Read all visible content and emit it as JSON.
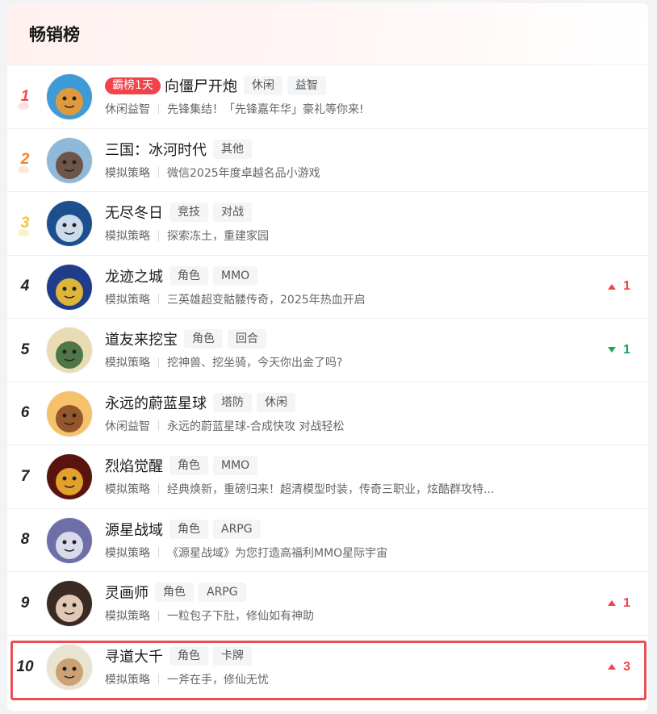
{
  "panel": {
    "title": "畅销榜"
  },
  "rows": [
    {
      "rank": "1",
      "badge": "霸榜1天",
      "name": "向僵尸开炮",
      "tags": [
        "休闲",
        "益智"
      ],
      "category": "休闲益智",
      "desc": "先锋集结！「先锋嘉年华」豪礼等你来!",
      "change": "",
      "dir": "",
      "avatar_bg": "#3f9ad8",
      "avatar_fg": "#f29a2e"
    },
    {
      "rank": "2",
      "badge": "",
      "name": "三国：冰河时代",
      "tags": [
        "其他"
      ],
      "category": "模拟策略",
      "desc": "微信2025年度卓越名品小游戏",
      "change": "",
      "dir": "",
      "avatar_bg": "#8fb9d8",
      "avatar_fg": "#6b4a3a"
    },
    {
      "rank": "3",
      "badge": "",
      "name": "无尽冬日",
      "tags": [
        "竞技",
        "对战"
      ],
      "category": "模拟策略",
      "desc": "探索冻土，重建家园",
      "change": "",
      "dir": "",
      "avatar_bg": "#1d4f8e",
      "avatar_fg": "#dfeaf6"
    },
    {
      "rank": "4",
      "badge": "",
      "name": "龙迹之城",
      "tags": [
        "角色",
        "MMO"
      ],
      "category": "模拟策略",
      "desc": "三英雄超变骷髅传奇，2025年热血开启",
      "change": "1",
      "dir": "up",
      "avatar_bg": "#1f3d8a",
      "avatar_fg": "#f2c230"
    },
    {
      "rank": "5",
      "badge": "",
      "name": "道友来挖宝",
      "tags": [
        "角色",
        "回合"
      ],
      "category": "模拟策略",
      "desc": "挖神兽、挖坐骑，今天你出金了吗?",
      "change": "1",
      "dir": "down",
      "avatar_bg": "#e9dcb4",
      "avatar_fg": "#3d6a3a"
    },
    {
      "rank": "6",
      "badge": "",
      "name": "永远的蔚蓝星球",
      "tags": [
        "塔防",
        "休闲"
      ],
      "category": "休闲益智",
      "desc": "永远的蔚蓝星球-合成快攻 对战轻松",
      "change": "",
      "dir": "",
      "avatar_bg": "#f5c26b",
      "avatar_fg": "#8a4a24"
    },
    {
      "rank": "7",
      "badge": "",
      "name": "烈焰觉醒",
      "tags": [
        "角色",
        "MMO"
      ],
      "category": "模拟策略",
      "desc": "经典焕新，重磅归来！超清模型时装，传奇三职业，炫酷群攻特...",
      "change": "",
      "dir": "",
      "avatar_bg": "#5a1410",
      "avatar_fg": "#f0b030"
    },
    {
      "rank": "8",
      "badge": "",
      "name": "源星战域",
      "tags": [
        "角色",
        "ARPG"
      ],
      "category": "模拟策略",
      "desc": "《源星战域》为您打造高福利MMO星际宇宙",
      "change": "",
      "dir": "",
      "avatar_bg": "#6e6fa8",
      "avatar_fg": "#e6e6f2"
    },
    {
      "rank": "9",
      "badge": "",
      "name": "灵画师",
      "tags": [
        "角色",
        "ARPG"
      ],
      "category": "模拟策略",
      "desc": "一粒包子下肚，修仙如有神助",
      "change": "1",
      "dir": "up",
      "avatar_bg": "#3a2a24",
      "avatar_fg": "#f3d9c4"
    },
    {
      "rank": "10",
      "badge": "",
      "name": "寻道大千",
      "tags": [
        "角色",
        "卡牌"
      ],
      "category": "模拟策略",
      "desc": "一斧在手，修仙无忧",
      "change": "3",
      "dir": "up",
      "avatar_bg": "#e9e4d2",
      "avatar_fg": "#c99a6a"
    }
  ]
}
